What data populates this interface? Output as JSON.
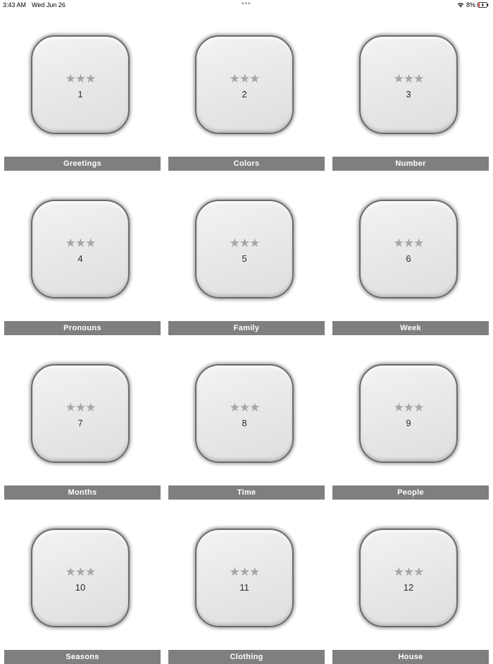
{
  "status": {
    "time": "3:43 AM",
    "date": "Wed Jun 26",
    "dots": "•••",
    "battery": "8%"
  },
  "levels": [
    {
      "number": "1",
      "name": "Greetings",
      "stars": "★★★"
    },
    {
      "number": "2",
      "name": "Colors",
      "stars": "★★★"
    },
    {
      "number": "3",
      "name": "Number",
      "stars": "★★★"
    },
    {
      "number": "4",
      "name": "Pronouns",
      "stars": "★★★"
    },
    {
      "number": "5",
      "name": "Family",
      "stars": "★★★"
    },
    {
      "number": "6",
      "name": "Week",
      "stars": "★★★"
    },
    {
      "number": "7",
      "name": "Months",
      "stars": "★★★"
    },
    {
      "number": "8",
      "name": "Time",
      "stars": "★★★"
    },
    {
      "number": "9",
      "name": "People",
      "stars": "★★★"
    },
    {
      "number": "10",
      "name": "Seasons",
      "stars": "★★★"
    },
    {
      "number": "11",
      "name": "Clothing",
      "stars": "★★★"
    },
    {
      "number": "12",
      "name": "House",
      "stars": "★★★"
    }
  ],
  "colors": {
    "label_background": "#7f7f7f",
    "star": "#a6a6a6",
    "tile_border": "#6a6a6a"
  }
}
